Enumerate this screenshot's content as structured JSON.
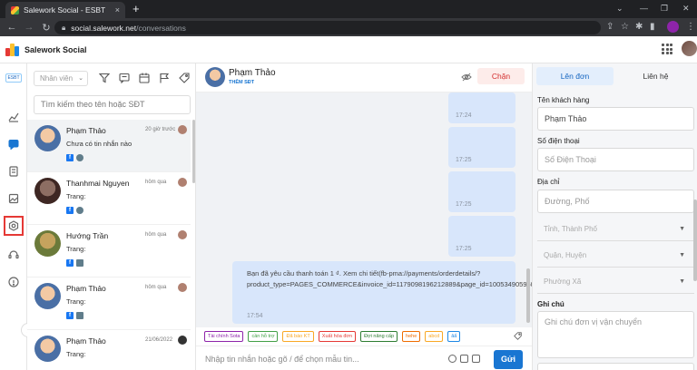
{
  "browser": {
    "tab_title": "Salework Social - ESBT",
    "tab_close": "×",
    "new_tab": "+",
    "url_domain": "social.salework.net",
    "url_path": "/conversations",
    "window_controls": [
      "⌄",
      "—",
      "❐",
      "✕"
    ]
  },
  "app": {
    "title": "Salework Social"
  },
  "conversations": {
    "staff_filter_placeholder": "Nhân viên",
    "search_placeholder": "Tìm kiếm theo tên hoặc SĐT",
    "items": [
      {
        "name": "Phạm Thảo",
        "time": "20 giờ trước",
        "preview": "Chưa có tin nhắn nào",
        "avatar_colors": [
          "#f3c9a4",
          "#4a6fa5"
        ]
      },
      {
        "name": "Thanhmai Nguyen",
        "time": "hôm qua",
        "preview": "Trang:",
        "avatar_colors": [
          "#8d6e63",
          "#3e2723"
        ]
      },
      {
        "name": "Hướng Trần",
        "time": "hôm qua",
        "preview": "Trang:",
        "avatar_colors": [
          "#c5a35e",
          "#6b7a3a"
        ]
      },
      {
        "name": "Phạm Thảo",
        "time": "hôm qua",
        "preview": "Trang:",
        "avatar_colors": [
          "#f3c9a4",
          "#4a6fa5"
        ]
      },
      {
        "name": "Phạm Thảo",
        "time": "21/06/2022",
        "preview": "Trang:",
        "avatar_colors": [
          "#f3c9a4",
          "#4a6fa5"
        ]
      }
    ]
  },
  "chat": {
    "contact_name": "Phạm Thảo",
    "add_phone": "THÊM SĐT",
    "block_label": "Chặn",
    "messages": [
      {
        "time": "17:24",
        "text": ""
      },
      {
        "time": "17:25",
        "text": ""
      },
      {
        "time": "17:25",
        "text": ""
      },
      {
        "time": "17:25",
        "text": ""
      },
      {
        "time": "17:54",
        "text": "Bạn đã yêu cầu thanh toán 1 ₫. Xem chi tiết(fb-pma://payments/orderdetails/?product_type=PAGES_COMMERCE&invoice_id=1179098196212889&page_id=100534905950515)"
      }
    ],
    "quick_replies": [
      {
        "label": "Tài chính Sota",
        "color": "#8e24aa"
      },
      {
        "label": "cần hỗ trợ",
        "color": "#43a047"
      },
      {
        "label": "Đã báo KT",
        "color": "#f9a825"
      },
      {
        "label": "Xuất hóa đơn",
        "color": "#e53935"
      },
      {
        "label": "Đợi nâng cấp",
        "color": "#2e7d32"
      },
      {
        "label": "hehe",
        "color": "#ef6c00"
      },
      {
        "label": "abcd",
        "color": "#f9a825"
      },
      {
        "label": "âẩ",
        "color": "#1e88e5"
      }
    ],
    "composer_placeholder": "Nhập tin nhắn hoặc gõ / để chọn mẫu tin...",
    "send_label": "Gửi"
  },
  "order": {
    "tab_order": "Lên đơn",
    "tab_contact": "Liên hệ",
    "customer_name_label": "Tên khách hàng",
    "customer_name_value": "Phạm Thảo",
    "phone_label": "Số điện thoại",
    "phone_placeholder": "Số Điện Thoại",
    "address_label": "Địa chỉ",
    "address_placeholder": "Đường, Phố",
    "province_placeholder": "Tỉnh, Thành Phố",
    "district_placeholder": "Quận, Huyện",
    "ward_placeholder": "Phường Xã",
    "note_label": "Ghi chú",
    "note_placeholder": "Ghi chú đơn vị vận chuyển"
  },
  "colors": {
    "accent": "#1976d2",
    "block_bg": "#fdecea",
    "block_text": "#d32f2f",
    "bubble": "#d8e6fb",
    "chat_bg": "#f0f2f5"
  }
}
